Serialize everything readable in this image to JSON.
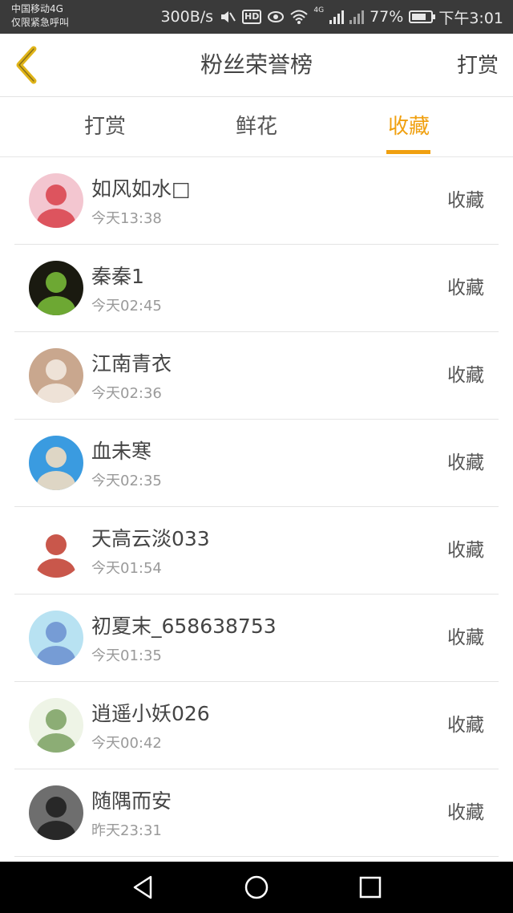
{
  "status_bar": {
    "carrier_line1": "中国移动4G",
    "carrier_line2": "仅限紧急呼叫",
    "speed": "300B/s",
    "hd": "HD",
    "network": "4G",
    "battery_percent": "77%",
    "battery_level": 0.77,
    "time": "下午3:01"
  },
  "header": {
    "title": "粉丝荣誉榜",
    "action": "打赏"
  },
  "tabs": [
    {
      "label": "打赏",
      "active": false
    },
    {
      "label": "鲜花",
      "active": false
    },
    {
      "label": "收藏",
      "active": true
    }
  ],
  "items": [
    {
      "name": "如风如水□",
      "time": "今天13:38",
      "action": "收藏",
      "avatar_bg": "#f3c6d0",
      "avatar_fg": "#d8404a"
    },
    {
      "name": "秦秦1",
      "time": "今天02:45",
      "action": "收藏",
      "avatar_bg": "#1a1a10",
      "avatar_fg": "#7cc23a"
    },
    {
      "name": "江南青衣",
      "time": "今天02:36",
      "action": "收藏",
      "avatar_bg": "#c9a78e",
      "avatar_fg": "#f4ece4"
    },
    {
      "name": "血未寒",
      "time": "今天02:35",
      "action": "收藏",
      "avatar_bg": "#3a9be0",
      "avatar_fg": "#fbe0c0"
    },
    {
      "name": "天高云淡033",
      "time": "今天01:54",
      "action": "收藏",
      "avatar_bg": "#ffffff",
      "avatar_fg": "#c0392b"
    },
    {
      "name": "初夏末_658638753",
      "time": "今天01:35",
      "action": "收藏",
      "avatar_bg": "#b8e2f2",
      "avatar_fg": "#6a8fd0"
    },
    {
      "name": "逍遥小妖026",
      "time": "今天00:42",
      "action": "收藏",
      "avatar_bg": "#eef4e6",
      "avatar_fg": "#7aa060"
    },
    {
      "name": "随隅而安",
      "time": "昨天23:31",
      "action": "收藏",
      "avatar_bg": "#6e6e6e",
      "avatar_fg": "#1c1c1c"
    }
  ],
  "icons": {
    "back": "chevron-left-icon",
    "nav_back": "triangle-back-icon",
    "nav_home": "circle-home-icon",
    "nav_recent": "square-recent-icon"
  },
  "colors": {
    "accent": "#f0a010",
    "status_bar": "#3a3a3a",
    "nav_bar": "#000000"
  }
}
